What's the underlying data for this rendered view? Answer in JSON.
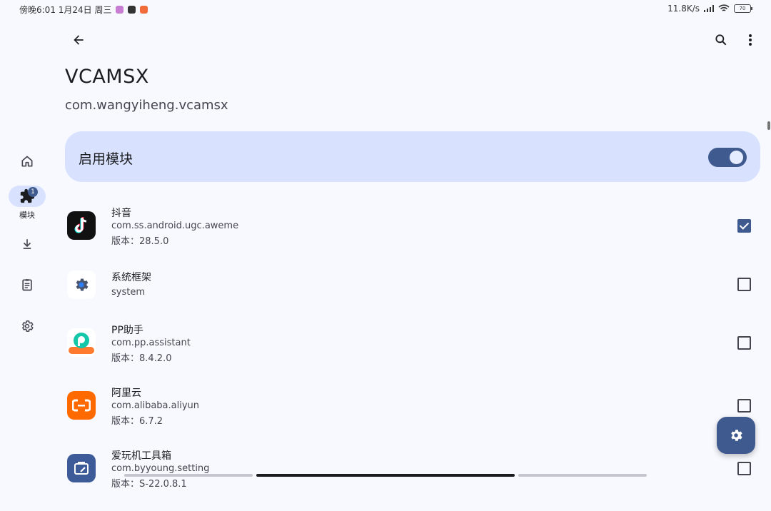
{
  "status_bar": {
    "time": "傍晚6:01 1月24日 周三",
    "network_speed": "11.8K/s",
    "battery": "70"
  },
  "toolbar": {
    "back_icon": "arrow-left-icon",
    "search_icon": "search-icon",
    "more_icon": "more-vertical-icon"
  },
  "module": {
    "title": "VCAMSX",
    "package": "com.wangyiheng.vcamsx"
  },
  "enable_card": {
    "label": "启用模块",
    "enabled": true
  },
  "nav": {
    "items": [
      {
        "icon": "home-icon",
        "label": ""
      },
      {
        "icon": "extension-icon",
        "label": "模块",
        "badge": "1",
        "active": true
      },
      {
        "icon": "download-icon",
        "label": ""
      },
      {
        "icon": "clipboard-icon",
        "label": ""
      },
      {
        "icon": "gear-icon",
        "label": ""
      }
    ]
  },
  "apps": [
    {
      "name": "抖音",
      "package": "com.ss.android.ugc.aweme",
      "version": "版本：28.5.0",
      "checked": true
    },
    {
      "name": "系统框架",
      "package": "system",
      "version": "",
      "checked": false
    },
    {
      "name": "PP助手",
      "package": "com.pp.assistant",
      "version": "版本：8.4.2.0",
      "checked": false
    },
    {
      "name": "阿里云",
      "package": "com.alibaba.aliyun",
      "version": "版本：6.7.2",
      "checked": false
    },
    {
      "name": "爱玩机工具箱",
      "package": "com.byyoung.setting",
      "version": "版本：S-22.0.8.1",
      "checked": false
    }
  ],
  "fab": {
    "icon": "gear-icon"
  },
  "colors": {
    "accent": "#3f5a8e",
    "card": "#d8e2ff",
    "background": "#f8f9ff"
  }
}
